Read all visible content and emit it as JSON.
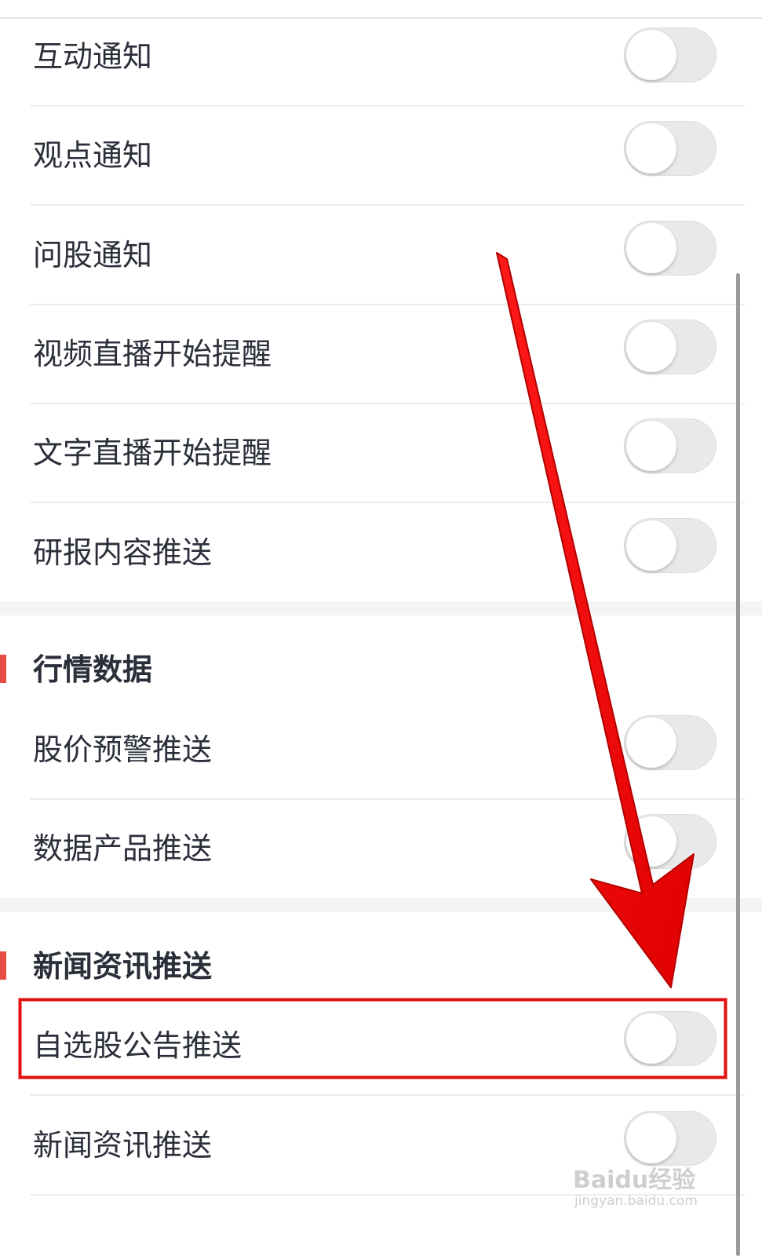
{
  "notification_rows": [
    {
      "label": "互动通知",
      "enabled": false
    },
    {
      "label": "观点通知",
      "enabled": false
    },
    {
      "label": "问股通知",
      "enabled": false
    },
    {
      "label": "视频直播开始提醒",
      "enabled": false
    },
    {
      "label": "文字直播开始提醒",
      "enabled": false
    },
    {
      "label": "研报内容推送",
      "enabled": false
    }
  ],
  "market_section": {
    "title": "行情数据",
    "rows": [
      {
        "label": "股价预警推送",
        "enabled": false
      },
      {
        "label": "数据产品推送",
        "enabled": false
      }
    ]
  },
  "news_section": {
    "title": "新闻资讯推送",
    "rows": [
      {
        "label": "自选股公告推送",
        "enabled": false
      },
      {
        "label": "新闻资讯推送",
        "enabled": false
      }
    ]
  },
  "watermark": {
    "brand": "Baidu经验",
    "domain": "jingyan.baidu.com"
  },
  "colors": {
    "accent": "#e54d42",
    "annotation": "#e01010",
    "toggle_off": "#e9e9e9"
  }
}
